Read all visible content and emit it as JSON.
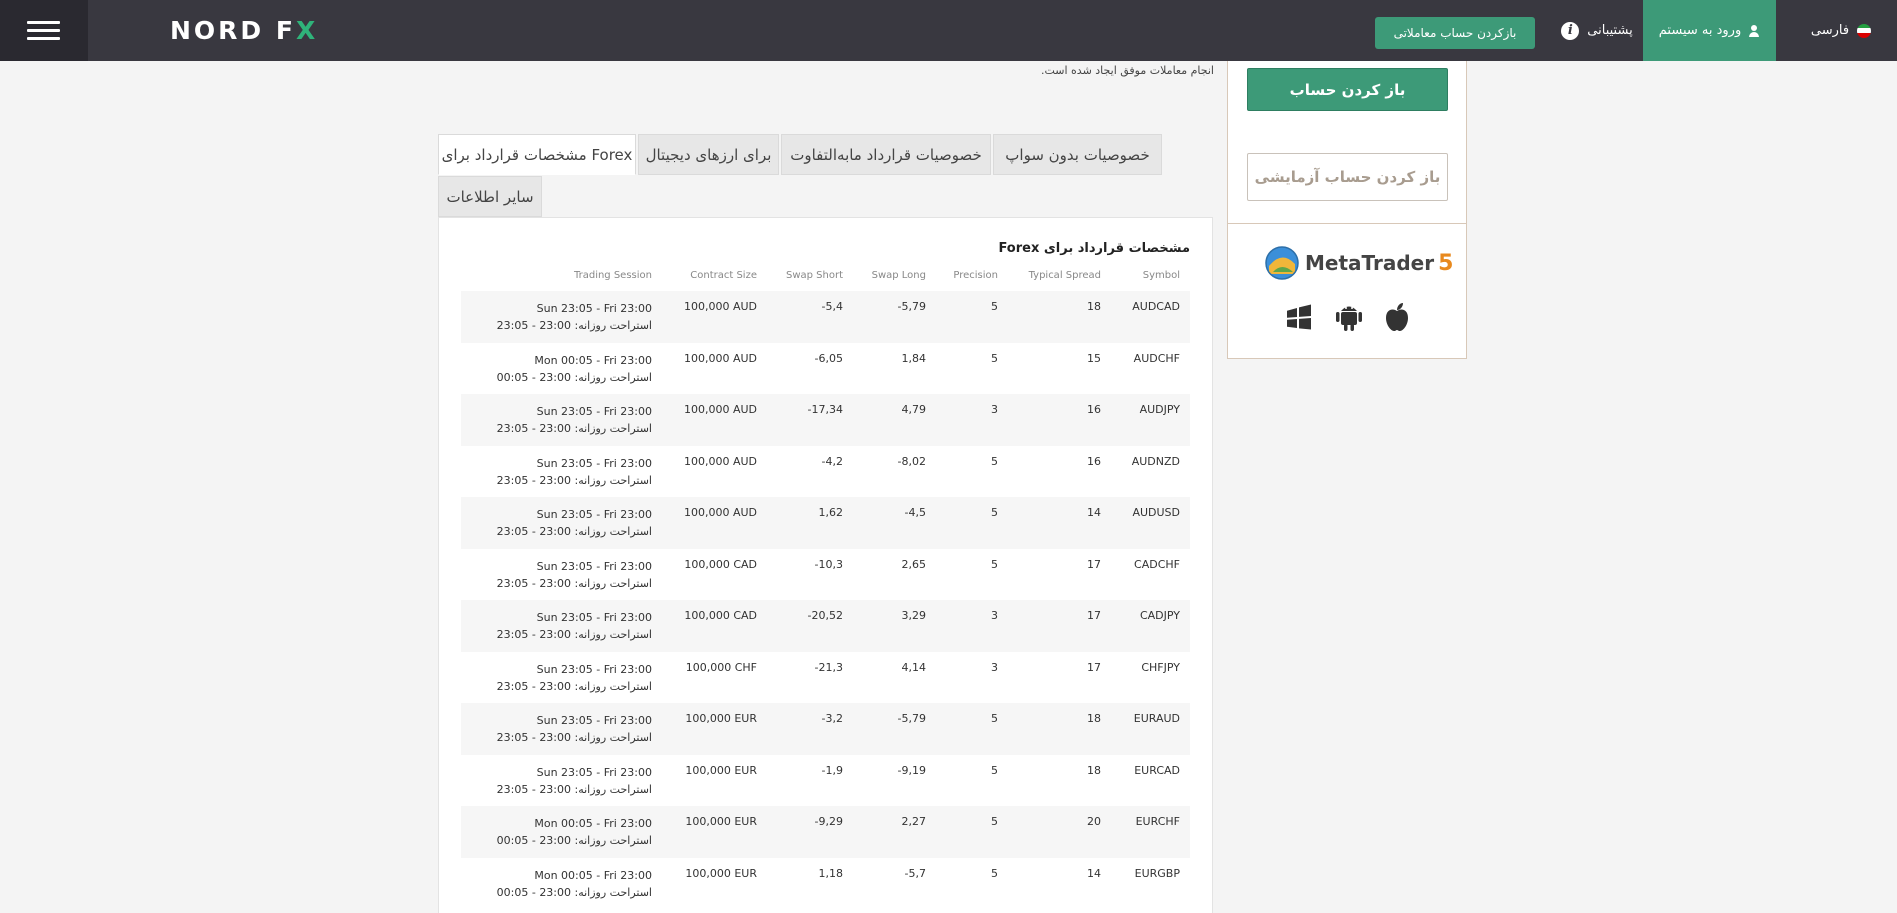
{
  "header": {
    "logo_main": "NORD F",
    "logo_x": "X",
    "open_trading_account": "بازکردن حساب معاملاتی",
    "support": "پشتیبانی",
    "login": "ورود به سیستم",
    "language": "فارسی"
  },
  "intro": {
    "line1": "انجام معاملات موفق ایجاد شده است."
  },
  "tabs": [
    {
      "label": "مشخصات قرارداد برای Forex",
      "active": true
    },
    {
      "label": "برای ارزهای دیجیتال",
      "active": false
    },
    {
      "label": "خصوصیات قرارداد مابه‌التفاوت",
      "active": false
    },
    {
      "label": "خصوصیات بدون سواپ",
      "active": false
    },
    {
      "label": "سایر اطلاعات",
      "active": false
    }
  ],
  "table": {
    "title": "مشخصات قرارداد برای Forex",
    "columns": {
      "symbol": "Symbol",
      "typical_spread": "Typical Spread",
      "precision": "Precision",
      "swap_long": "Swap Long",
      "swap_short": "Swap Short",
      "contract_size": "Contract Size",
      "trading_session": "Trading Session"
    },
    "rows": [
      {
        "symbol": "AUDCAD",
        "spread": "18",
        "precision": "5",
        "swap_long": "-5,79",
        "swap_short": "-5,4",
        "contract": "100,000 AUD",
        "session": "Sun 23:05 - Fri 23:00",
        "break": "استراحت روزانه: 23:00 - 23:05"
      },
      {
        "symbol": "AUDCHF",
        "spread": "15",
        "precision": "5",
        "swap_long": "1,84",
        "swap_short": "-6,05",
        "contract": "100,000 AUD",
        "session": "Mon 00:05 - Fri 23:00",
        "break": "استراحت روزانه: 23:00 - 00:05"
      },
      {
        "symbol": "AUDJPY",
        "spread": "16",
        "precision": "3",
        "swap_long": "4,79",
        "swap_short": "-17,34",
        "contract": "100,000 AUD",
        "session": "Sun 23:05 - Fri 23:00",
        "break": "استراحت روزانه: 23:00 - 23:05"
      },
      {
        "symbol": "AUDNZD",
        "spread": "16",
        "precision": "5",
        "swap_long": "-8,02",
        "swap_short": "-4,2",
        "contract": "100,000 AUD",
        "session": "Sun 23:05 - Fri 23:00",
        "break": "استراحت روزانه: 23:00 - 23:05"
      },
      {
        "symbol": "AUDUSD",
        "spread": "14",
        "precision": "5",
        "swap_long": "-4,5",
        "swap_short": "1,62",
        "contract": "100,000 AUD",
        "session": "Sun 23:05 - Fri 23:00",
        "break": "استراحت روزانه: 23:00 - 23:05"
      },
      {
        "symbol": "CADCHF",
        "spread": "17",
        "precision": "5",
        "swap_long": "2,65",
        "swap_short": "-10,3",
        "contract": "100,000 CAD",
        "session": "Sun 23:05 - Fri 23:00",
        "break": "استراحت روزانه: 23:00 - 23:05"
      },
      {
        "symbol": "CADJPY",
        "spread": "17",
        "precision": "3",
        "swap_long": "3,29",
        "swap_short": "-20,52",
        "contract": "100,000 CAD",
        "session": "Sun 23:05 - Fri 23:00",
        "break": "استراحت روزانه: 23:00 - 23:05"
      },
      {
        "symbol": "CHFJPY",
        "spread": "17",
        "precision": "3",
        "swap_long": "4,14",
        "swap_short": "-21,3",
        "contract": "100,000 CHF",
        "session": "Sun 23:05 - Fri 23:00",
        "break": "استراحت روزانه: 23:00 - 23:05"
      },
      {
        "symbol": "EURAUD",
        "spread": "18",
        "precision": "5",
        "swap_long": "-5,79",
        "swap_short": "-3,2",
        "contract": "100,000 EUR",
        "session": "Sun 23:05 - Fri 23:00",
        "break": "استراحت روزانه: 23:00 - 23:05"
      },
      {
        "symbol": "EURCAD",
        "spread": "18",
        "precision": "5",
        "swap_long": "-9,19",
        "swap_short": "-1,9",
        "contract": "100,000 EUR",
        "session": "Sun 23:05 - Fri 23:00",
        "break": "استراحت روزانه: 23:00 - 23:05"
      },
      {
        "symbol": "EURCHF",
        "spread": "20",
        "precision": "5",
        "swap_long": "2,27",
        "swap_short": "-9,29",
        "contract": "100,000 EUR",
        "session": "Mon 00:05 - Fri 23:00",
        "break": "استراحت روزانه: 23:00 - 00:05"
      },
      {
        "symbol": "EURGBP",
        "spread": "14",
        "precision": "5",
        "swap_long": "-5,7",
        "swap_short": "1,18",
        "contract": "100,000 EUR",
        "session": "Mon 00:05 - Fri 23:00",
        "break": "استراحت روزانه: 23:00 - 00:05"
      }
    ]
  },
  "sidebar": {
    "open_account": "باز کردن حساب",
    "open_demo": "باز کردن حساب آزمایشی",
    "metatrader_name": "MetaTrader",
    "metatrader_version": "5",
    "platforms": [
      "windows-icon",
      "android-icon",
      "apple-icon"
    ]
  },
  "colors": {
    "header_bg": "#393840",
    "accent_green": "#3d9a78"
  }
}
